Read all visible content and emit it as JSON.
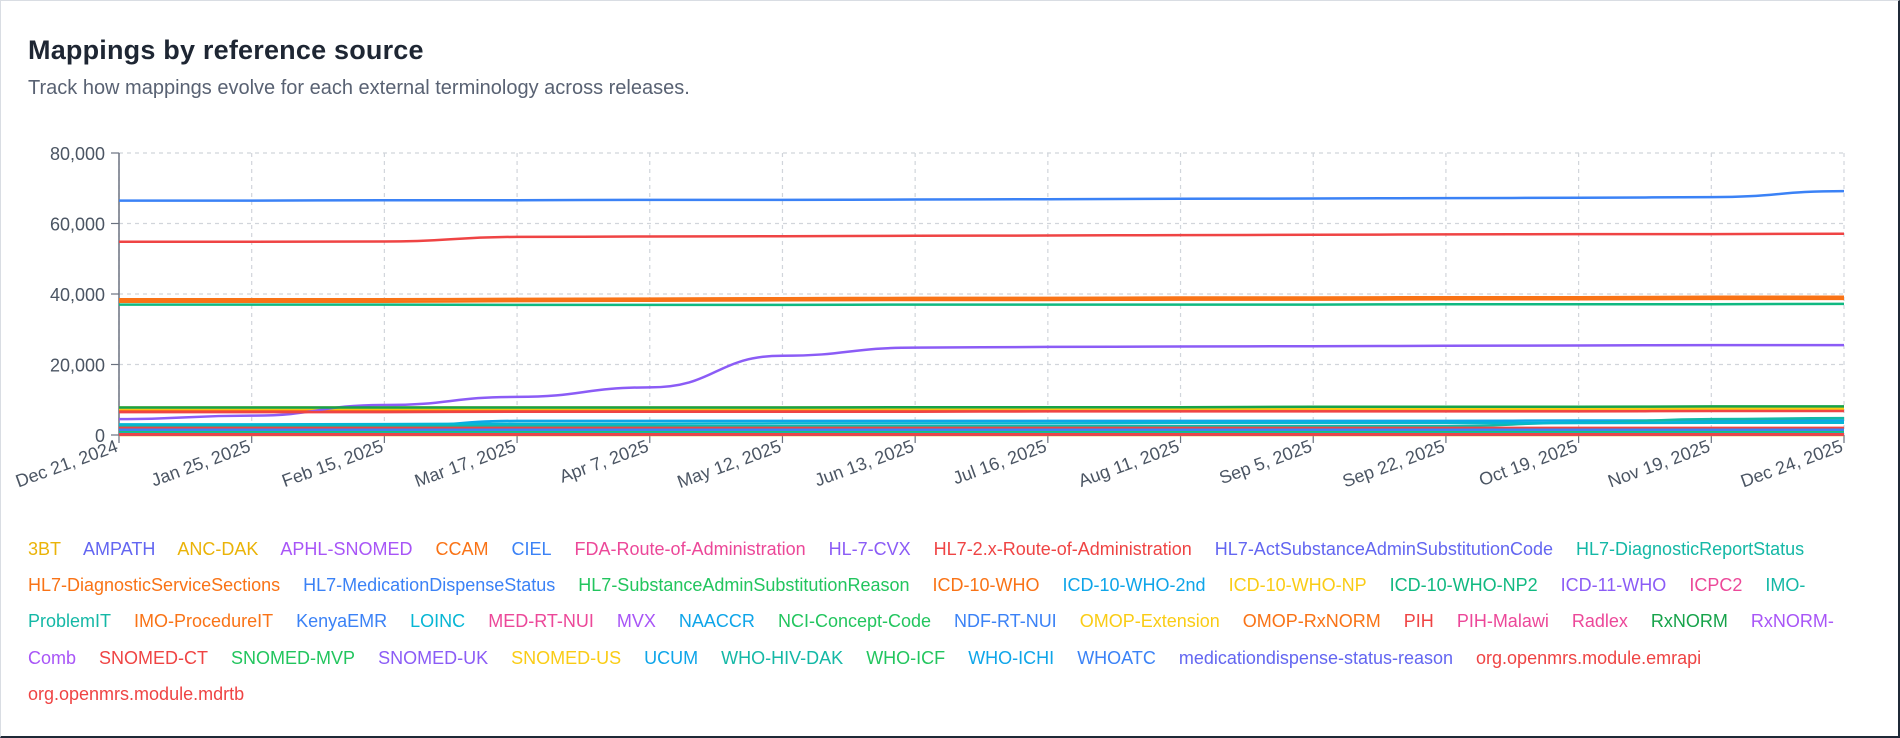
{
  "header": {
    "title": "Mappings by reference source",
    "subtitle": "Track how mappings evolve for each external terminology across releases."
  },
  "chart_data": {
    "type": "line",
    "title": "Mappings by reference source",
    "subtitle": "Track how mappings evolve for each external terminology across releases.",
    "xlabel": "",
    "ylabel": "",
    "grid": true,
    "legend_placement": "bottom",
    "ylim": [
      0,
      80000
    ],
    "y_ticks": [
      0,
      20000,
      40000,
      60000,
      80000
    ],
    "y_tick_labels": [
      "0",
      "20,000",
      "40,000",
      "60,000",
      "80,000"
    ],
    "x": [
      "Dec 21, 2024",
      "Jan 25, 2025",
      "Feb 15, 2025",
      "Mar 17, 2025",
      "Apr 7, 2025",
      "May 12, 2025",
      "Jun 13, 2025",
      "Jul 16, 2025",
      "Aug 11, 2025",
      "Sep 5, 2025",
      "Sep 22, 2025",
      "Oct 19, 2025",
      "Nov 19, 2025",
      "Dec 24, 2025"
    ],
    "series": [
      {
        "name": "3BT",
        "color": "#eab308",
        "values": [
          0,
          0,
          0,
          0,
          0,
          0,
          0,
          0,
          0,
          0,
          0,
          0,
          0,
          0
        ]
      },
      {
        "name": "AMPATH",
        "color": "#6366f1",
        "values": [
          800,
          800,
          800,
          800,
          800,
          800,
          800,
          800,
          800,
          800,
          800,
          800,
          800,
          800
        ]
      },
      {
        "name": "ANC-DAK",
        "color": "#eab308",
        "values": [
          7800,
          7800,
          7800,
          7800,
          7800,
          7800,
          7800,
          7800,
          7800,
          7800,
          7800,
          7800,
          7800,
          7800
        ]
      },
      {
        "name": "APHL-SNOMED",
        "color": "#a855f7",
        "values": [
          200,
          200,
          200,
          200,
          200,
          200,
          200,
          200,
          200,
          200,
          200,
          200,
          200,
          200
        ]
      },
      {
        "name": "CCAM",
        "color": "#f97316",
        "values": [
          37800,
          37800,
          37800,
          38000,
          38100,
          38200,
          38300,
          38300,
          38400,
          38400,
          38500,
          38500,
          38600,
          38600
        ]
      },
      {
        "name": "CIEL",
        "color": "#3b82f6",
        "values": [
          66500,
          66500,
          66600,
          66600,
          66700,
          66700,
          66800,
          66900,
          67000,
          67100,
          67200,
          67300,
          67500,
          69200
        ]
      },
      {
        "name": "FDA-Route-of-Administration",
        "color": "#ec4899",
        "values": [
          100,
          100,
          100,
          100,
          100,
          100,
          100,
          100,
          100,
          100,
          100,
          100,
          100,
          100
        ]
      },
      {
        "name": "HL-7-CVX",
        "color": "#8b5cf6",
        "values": [
          300,
          300,
          300,
          300,
          300,
          300,
          300,
          300,
          300,
          300,
          300,
          300,
          300,
          300
        ]
      },
      {
        "name": "HL7-2.x-Route-of-Administration",
        "color": "#ef4444",
        "values": [
          54800,
          54800,
          54900,
          56200,
          56300,
          56400,
          56500,
          56600,
          56700,
          56800,
          56900,
          57000,
          57000,
          57100
        ]
      },
      {
        "name": "HL7-ActSubstanceAdminSubstitutionCode",
        "color": "#6366f1",
        "values": [
          100,
          100,
          100,
          100,
          100,
          100,
          100,
          100,
          100,
          100,
          100,
          100,
          100,
          100
        ]
      },
      {
        "name": "HL7-DiagnosticReportStatus",
        "color": "#14b8a6",
        "values": [
          100,
          100,
          100,
          100,
          100,
          100,
          100,
          100,
          100,
          100,
          100,
          100,
          100,
          100
        ]
      },
      {
        "name": "HL7-DiagnosticServiceSections",
        "color": "#f97316",
        "values": [
          38500,
          38500,
          38500,
          38600,
          38700,
          38800,
          38900,
          38900,
          39000,
          39000,
          39100,
          39100,
          39200,
          39200
        ]
      },
      {
        "name": "HL7-MedicationDispenseStatus",
        "color": "#3b82f6",
        "values": [
          100,
          100,
          100,
          100,
          100,
          100,
          100,
          100,
          100,
          100,
          100,
          100,
          100,
          100
        ]
      },
      {
        "name": "HL7-SubstanceAdminSubstitutionReason",
        "color": "#22c55e",
        "values": [
          100,
          100,
          100,
          100,
          100,
          100,
          100,
          100,
          100,
          100,
          100,
          100,
          100,
          100
        ]
      },
      {
        "name": "ICD-10-WHO",
        "color": "#f97316",
        "values": [
          7000,
          7000,
          7000,
          7100,
          7100,
          7100,
          7200,
          7200,
          7200,
          7200,
          7200,
          7300,
          7300,
          7300
        ]
      },
      {
        "name": "ICD-10-WHO-2nd",
        "color": "#0ea5e9",
        "values": [
          2000,
          2000,
          2200,
          4000,
          4000,
          4000,
          4000,
          4000,
          4000,
          4000,
          4000,
          4100,
          4100,
          4100
        ]
      },
      {
        "name": "ICD-10-WHO-NP",
        "color": "#facc15",
        "values": [
          7500,
          7500,
          7500,
          7500,
          7500,
          7500,
          7500,
          7500,
          7500,
          7500,
          7500,
          7500,
          7500,
          7500
        ]
      },
      {
        "name": "ICD-10-WHO-NP2",
        "color": "#10b981",
        "values": [
          37000,
          37000,
          37000,
          36900,
          36900,
          36900,
          37000,
          37000,
          37000,
          37000,
          37100,
          37100,
          37100,
          37200
        ]
      },
      {
        "name": "ICD-11-WHO",
        "color": "#8b5cf6",
        "values": [
          4500,
          5500,
          8500,
          10800,
          13500,
          22500,
          24800,
          25000,
          25100,
          25200,
          25300,
          25400,
          25500,
          25500
        ]
      },
      {
        "name": "ICPC2",
        "color": "#ec4899",
        "values": [
          1500,
          1500,
          1500,
          1500,
          1500,
          1500,
          1500,
          1500,
          1500,
          1500,
          1500,
          1500,
          1500,
          1500
        ]
      },
      {
        "name": "IMO-ProblemIT",
        "color": "#14b8a6",
        "values": [
          2500,
          2500,
          2500,
          2500,
          2500,
          2500,
          2500,
          2500,
          2500,
          2500,
          2500,
          3500,
          4500,
          4800
        ]
      },
      {
        "name": "IMO-ProcedureIT",
        "color": "#f97316",
        "values": [
          300,
          300,
          300,
          300,
          300,
          300,
          300,
          300,
          300,
          300,
          300,
          300,
          300,
          300
        ]
      },
      {
        "name": "KenyaEMR",
        "color": "#3b82f6",
        "values": [
          1200,
          1200,
          1200,
          1200,
          1200,
          1200,
          1200,
          1200,
          1200,
          1200,
          1200,
          1200,
          1200,
          1200
        ]
      },
      {
        "name": "LOINC",
        "color": "#06b6d4",
        "values": [
          3000,
          3000,
          3100,
          3200,
          3200,
          3300,
          3300,
          3300,
          3400,
          3400,
          3400,
          3400,
          3500,
          3500
        ]
      },
      {
        "name": "MED-RT-NUI",
        "color": "#ec4899",
        "values": [
          400,
          400,
          400,
          400,
          400,
          400,
          400,
          400,
          400,
          400,
          400,
          400,
          400,
          400
        ]
      },
      {
        "name": "MVX",
        "color": "#a855f7",
        "values": [
          100,
          100,
          100,
          100,
          100,
          100,
          100,
          100,
          100,
          100,
          100,
          100,
          100,
          100
        ]
      },
      {
        "name": "NAACCR",
        "color": "#0ea5e9",
        "values": [
          200,
          200,
          200,
          200,
          200,
          200,
          200,
          200,
          200,
          200,
          200,
          200,
          200,
          200
        ]
      },
      {
        "name": "NCI-Concept-Code",
        "color": "#22c55e",
        "values": [
          100,
          100,
          100,
          100,
          100,
          100,
          100,
          100,
          100,
          100,
          100,
          100,
          100,
          100
        ]
      },
      {
        "name": "NDF-RT-NUI",
        "color": "#3b82f6",
        "values": [
          500,
          500,
          500,
          500,
          500,
          500,
          500,
          500,
          500,
          500,
          500,
          500,
          500,
          500
        ]
      },
      {
        "name": "OMOP-Extension",
        "color": "#facc15",
        "values": [
          100,
          100,
          100,
          100,
          100,
          100,
          100,
          100,
          100,
          100,
          100,
          100,
          100,
          100
        ]
      },
      {
        "name": "OMOP-RxNORM",
        "color": "#f97316",
        "values": [
          600,
          600,
          600,
          600,
          600,
          600,
          600,
          600,
          600,
          600,
          600,
          600,
          600,
          600
        ]
      },
      {
        "name": "PIH",
        "color": "#ef4444",
        "values": [
          2000,
          2000,
          2000,
          2000,
          2000,
          2000,
          2000,
          2000,
          2000,
          2000,
          2000,
          2000,
          2000,
          2000
        ]
      },
      {
        "name": "PIH-Malawi",
        "color": "#ec4899",
        "values": [
          900,
          900,
          900,
          900,
          900,
          900,
          900,
          900,
          900,
          900,
          900,
          900,
          900,
          900
        ]
      },
      {
        "name": "Radlex",
        "color": "#ec4899",
        "values": [
          100,
          100,
          100,
          100,
          100,
          100,
          100,
          100,
          100,
          100,
          100,
          100,
          100,
          100
        ]
      },
      {
        "name": "RxNORM",
        "color": "#16a34a",
        "values": [
          7800,
          7800,
          7800,
          7800,
          7800,
          7800,
          7900,
          7900,
          7900,
          8000,
          8000,
          8000,
          8100,
          8100
        ]
      },
      {
        "name": "RxNORM-Comb",
        "color": "#a855f7",
        "values": [
          300,
          300,
          300,
          300,
          300,
          300,
          300,
          300,
          300,
          300,
          300,
          300,
          300,
          300
        ]
      },
      {
        "name": "SNOMED-CT",
        "color": "#ef4444",
        "values": [
          6500,
          6500,
          6500,
          6600,
          6600,
          6600,
          6600,
          6700,
          6700,
          6700,
          6700,
          6700,
          6800,
          6800
        ]
      },
      {
        "name": "SNOMED-MVP",
        "color": "#22c55e",
        "values": [
          1000,
          1000,
          1000,
          1000,
          1000,
          1000,
          1000,
          1000,
          1000,
          1000,
          1000,
          1000,
          1000,
          1000
        ]
      },
      {
        "name": "SNOMED-UK",
        "color": "#8b5cf6",
        "values": [
          400,
          400,
          400,
          400,
          400,
          400,
          400,
          400,
          400,
          400,
          400,
          400,
          400,
          400
        ]
      },
      {
        "name": "SNOMED-US",
        "color": "#facc15",
        "values": [
          200,
          200,
          200,
          200,
          200,
          200,
          200,
          200,
          200,
          200,
          200,
          200,
          200,
          200
        ]
      },
      {
        "name": "UCUM",
        "color": "#0ea5e9",
        "values": [
          100,
          100,
          100,
          100,
          100,
          100,
          100,
          100,
          100,
          100,
          100,
          100,
          100,
          100
        ]
      },
      {
        "name": "WHO-HIV-DAK",
        "color": "#14b8a6",
        "values": [
          600,
          600,
          600,
          600,
          600,
          600,
          600,
          600,
          600,
          600,
          600,
          600,
          600,
          600
        ]
      },
      {
        "name": "WHO-ICF",
        "color": "#22c55e",
        "values": [
          100,
          100,
          100,
          100,
          100,
          100,
          100,
          100,
          100,
          100,
          100,
          100,
          100,
          100
        ]
      },
      {
        "name": "WHO-ICHI",
        "color": "#0ea5e9",
        "values": [
          100,
          100,
          100,
          100,
          100,
          100,
          100,
          100,
          100,
          100,
          100,
          100,
          100,
          100
        ]
      },
      {
        "name": "WHOATC",
        "color": "#3b82f6",
        "values": [
          1500,
          1500,
          1500,
          1500,
          1500,
          1500,
          1500,
          1500,
          1500,
          1500,
          1500,
          1500,
          1500,
          1500
        ]
      },
      {
        "name": "medicationdispense-status-reason",
        "color": "#6366f1",
        "values": [
          100,
          100,
          100,
          100,
          100,
          100,
          100,
          100,
          100,
          100,
          100,
          100,
          100,
          100
        ]
      },
      {
        "name": "org.openmrs.module.emrapi",
        "color": "#ef4444",
        "values": [
          100,
          100,
          100,
          100,
          100,
          100,
          100,
          100,
          100,
          100,
          100,
          100,
          100,
          100
        ]
      },
      {
        "name": "org.openmrs.module.mdrtb",
        "color": "#ef4444",
        "values": [
          200,
          200,
          200,
          200,
          200,
          200,
          200,
          200,
          200,
          200,
          200,
          200,
          200,
          200
        ]
      }
    ]
  }
}
